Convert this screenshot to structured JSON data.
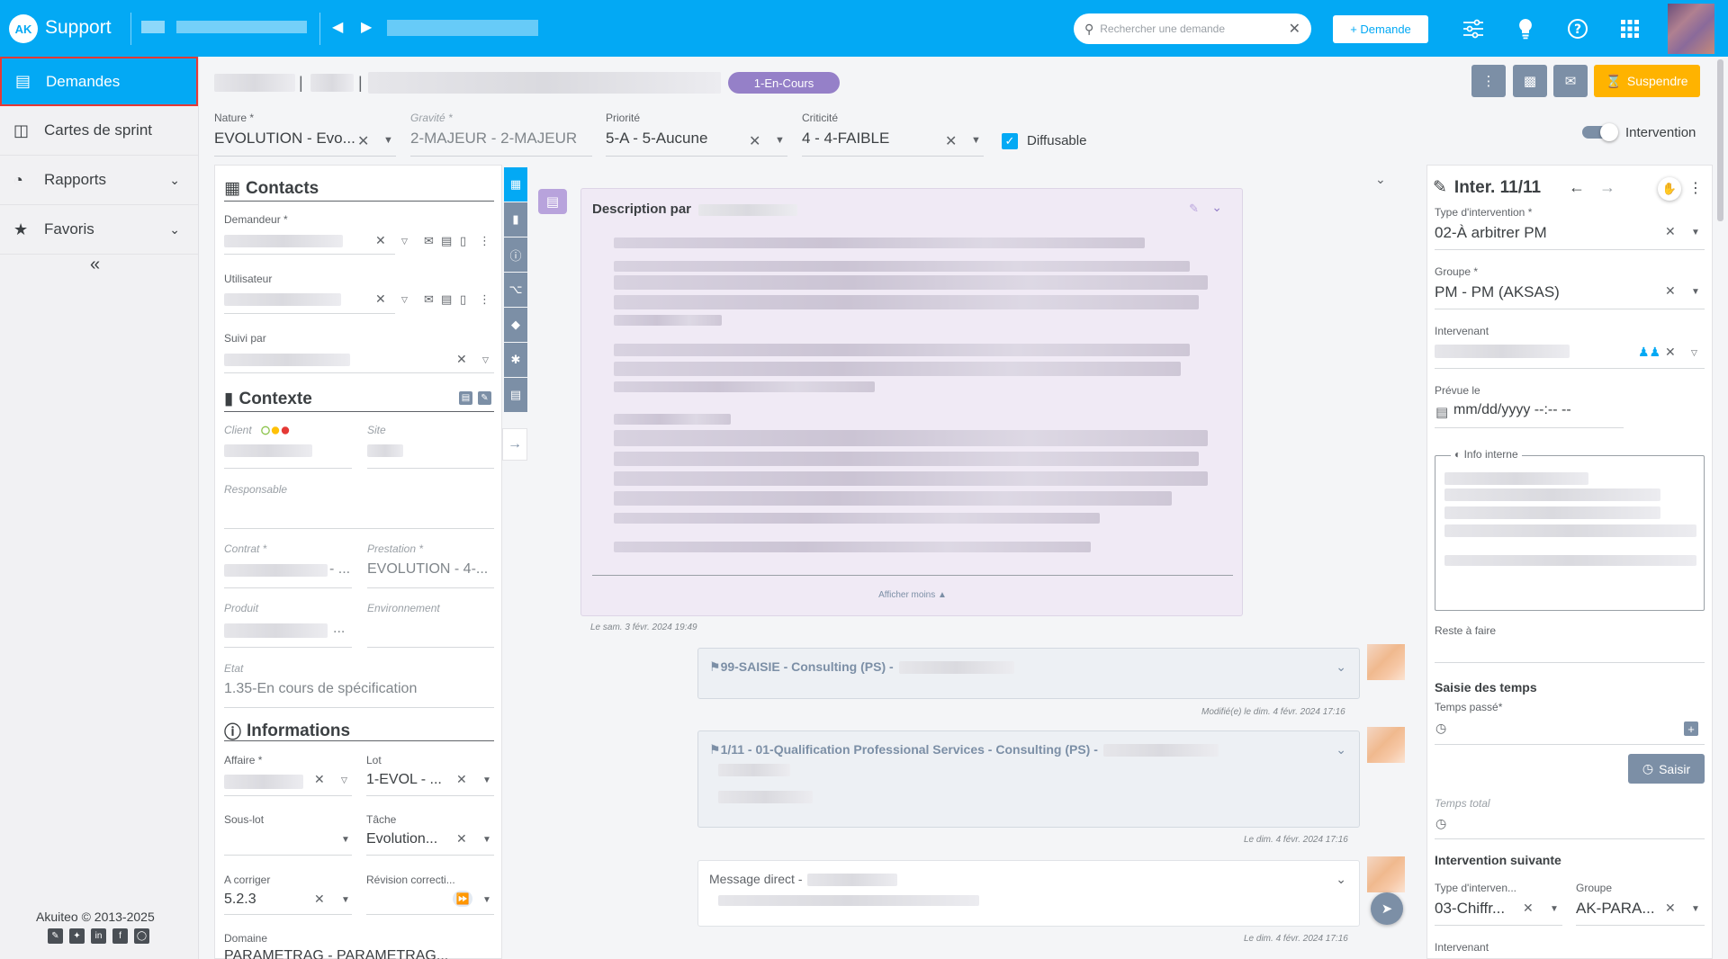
{
  "app": {
    "title": "Support",
    "logo_text": "AK"
  },
  "topbar": {
    "search_placeholder": "Rechercher une demande",
    "new_button": "+ Demande",
    "icons": [
      "filter-sliders-icon",
      "lightbulb-icon",
      "help-icon",
      "apps-grid-icon"
    ]
  },
  "sidebar": {
    "items": [
      {
        "label": "Demandes",
        "icon": "chat-icon",
        "active": true
      },
      {
        "label": "Cartes de sprint",
        "icon": "cards-icon"
      },
      {
        "label": "Rapports",
        "icon": "chart-icon",
        "expandable": true
      },
      {
        "label": "Favoris",
        "icon": "star-icon",
        "expandable": true
      }
    ],
    "collapse_symbol": "«",
    "footer_copy": "Akuiteo © 2013-2025"
  },
  "header": {
    "status": "1-En-Cours",
    "suspend_label": "Suspendre"
  },
  "fields": {
    "nature": {
      "label": "Nature *",
      "value": "EVOLUTION - Evo..."
    },
    "gravite": {
      "label": "Gravité *",
      "value": "2-MAJEUR - 2-MAJEUR"
    },
    "priorite": {
      "label": "Priorité",
      "value": "5-A - 5-Aucune"
    },
    "criticite": {
      "label": "Criticité",
      "value": "4 - 4-FAIBLE"
    },
    "diffusable": {
      "label": "Diffusable",
      "checked": true
    },
    "intervention": {
      "label": "Intervention",
      "on": true
    }
  },
  "contacts": {
    "title": "Contacts",
    "demandeur_label": "Demandeur *",
    "utilisateur_label": "Utilisateur",
    "suivi_label": "Suivi par"
  },
  "contexte": {
    "title": "Contexte",
    "client_label": "Client",
    "site_label": "Site",
    "responsable_label": "Responsable",
    "contrat_label": "Contrat *",
    "contrat_suffix": "- ...",
    "prestation_label": "Prestation *",
    "prestation_value": "EVOLUTION - 4-...",
    "produit_label": "Produit",
    "produit_suffix": "...",
    "environnement_label": "Environnement",
    "etat_label": "Etat",
    "etat_value": "1.35-En cours de spécification"
  },
  "informations": {
    "title": "Informations",
    "affaire_label": "Affaire *",
    "lot_label": "Lot",
    "lot_value": "1-EVOL - ...",
    "souslot_label": "Sous-lot",
    "tache_label": "Tâche",
    "tache_value": "Evolution...",
    "acorriger_label": "A corriger",
    "acorriger_value": "5.2.3",
    "revision_label": "Révision correcti...",
    "domaine_label": "Domaine",
    "domaine_value": "PARAMETRAG - PARAMETRAG..."
  },
  "description": {
    "title": "Description par",
    "show_less": "Afficher moins",
    "timestamp": "Le sam. 3 févr. 2024 19:49"
  },
  "messages": [
    {
      "title": "99-SAISIE - Consulting (PS) -",
      "timestamp": "Modifié(e) le dim. 4 févr. 2024 17:16"
    },
    {
      "title": "1/11 - 01-Qualification Professional Services - Consulting (PS) -",
      "timestamp": "Le dim. 4 févr. 2024 17:16"
    },
    {
      "title": "Message direct -",
      "timestamp": "Le dim. 4 févr. 2024 17:16"
    }
  ],
  "intervention": {
    "title": "Inter. 11/11",
    "type_label": "Type d'intervention *",
    "type_value": "02-À arbitrer PM",
    "groupe_label": "Groupe *",
    "groupe_value": "PM - PM (AKSAS)",
    "intervenant_label": "Intervenant",
    "prevue_label": "Prévue le",
    "prevue_placeholder": "mm/dd/yyyy --:-- --",
    "info_interne_label": "Info interne",
    "reste_label": "Reste à faire",
    "saisie_title": "Saisie des temps",
    "temps_passe_label": "Temps passé*",
    "saisir_label": "Saisir",
    "temps_total_label": "Temps total",
    "suivante_title": "Intervention suivante",
    "next_type_label": "Type d'interven...",
    "next_type_value": "03-Chiffr...",
    "next_groupe_label": "Groupe",
    "next_groupe_value": "AK-PARA...",
    "next_intervenant_label": "Intervenant"
  },
  "colors": {
    "primary": "#03a9f4",
    "status_pill": "#9580c8",
    "suspend": "#ffb300",
    "slate": "#7c8fa6",
    "description_bg": "#f0eaf5"
  }
}
